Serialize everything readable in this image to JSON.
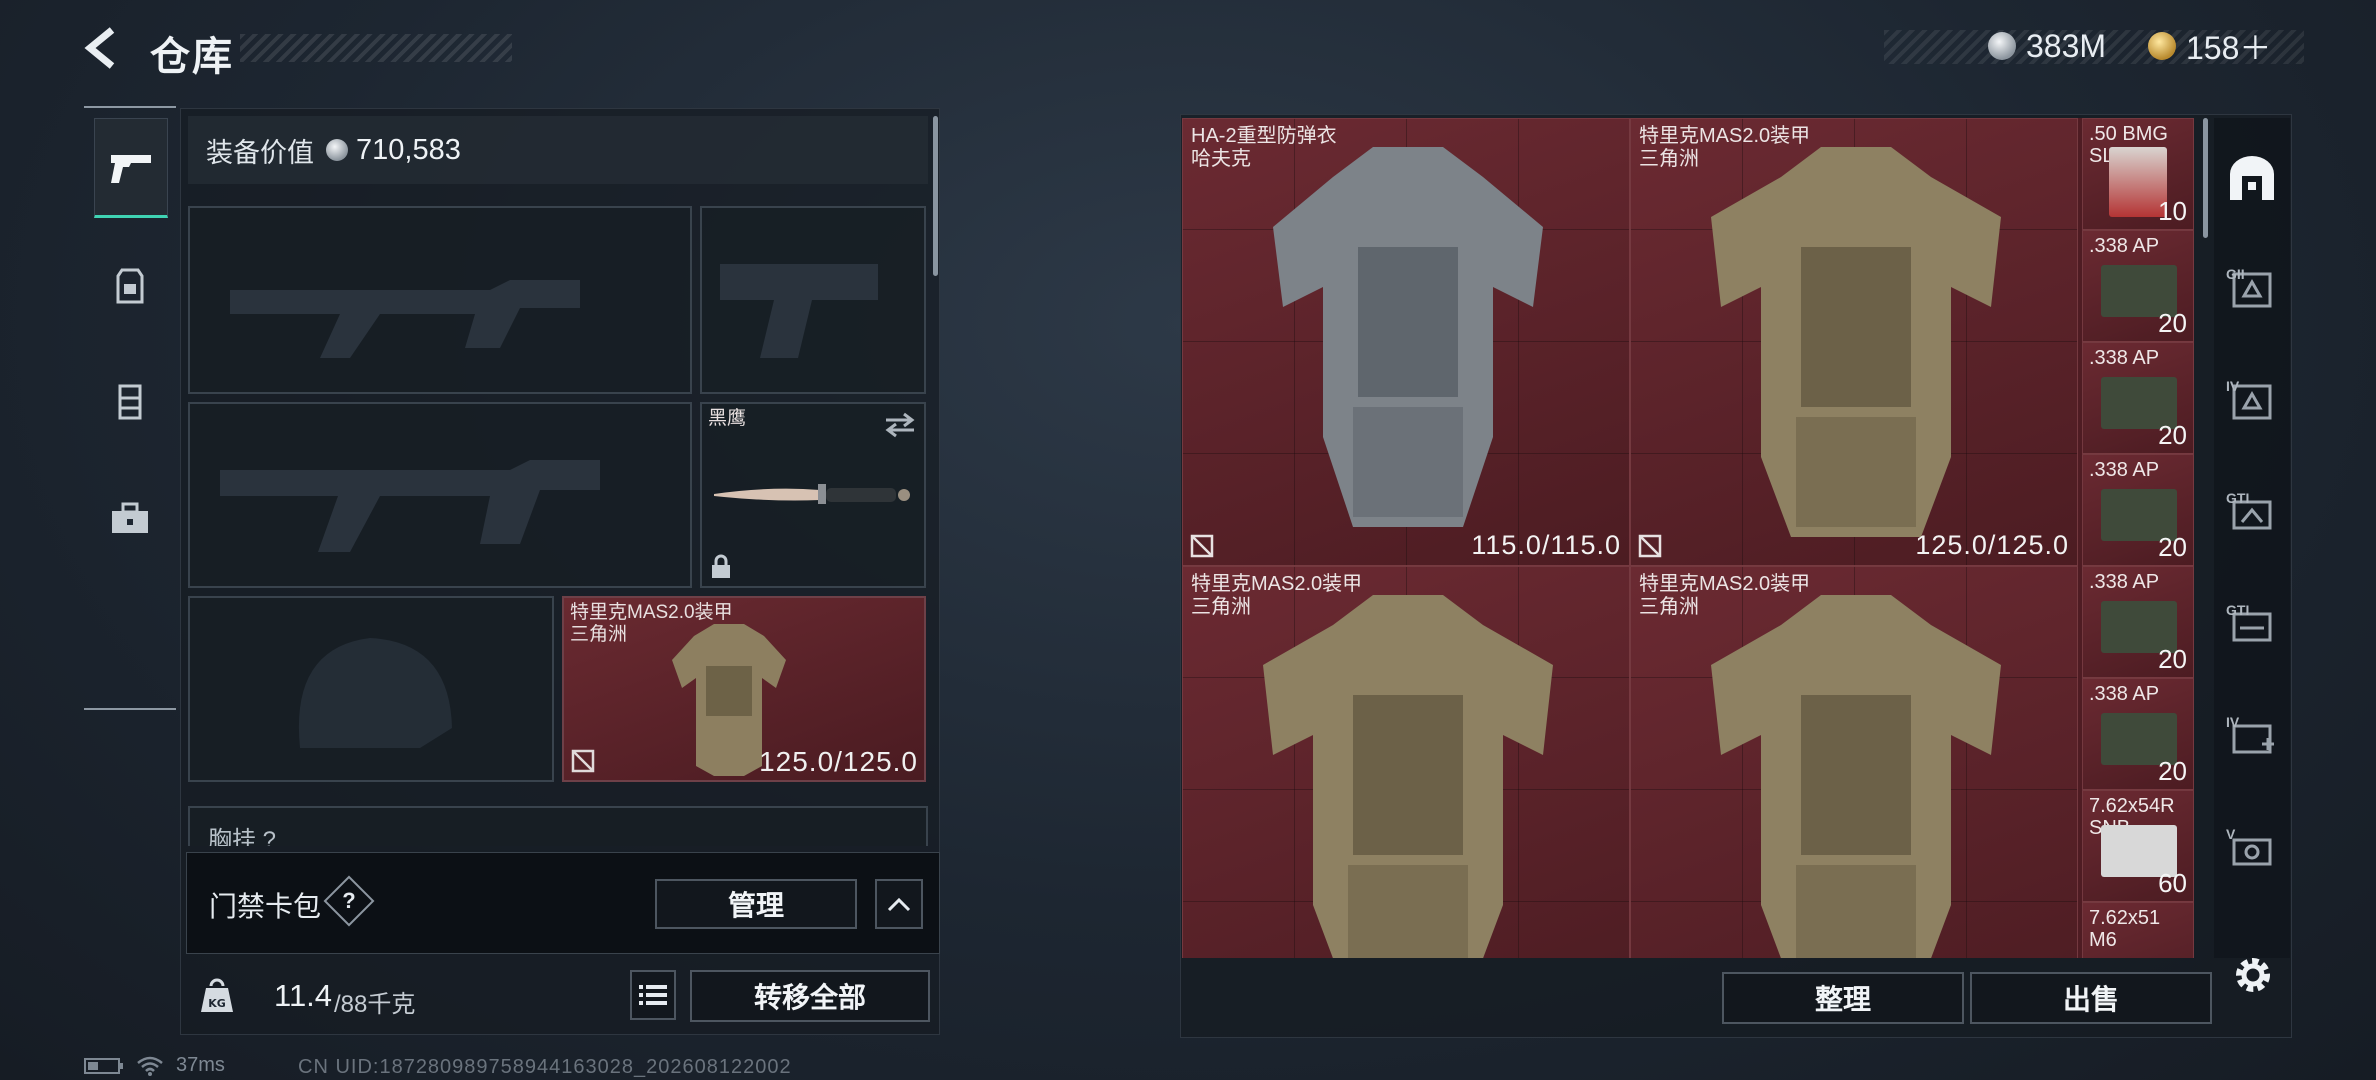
{
  "header": {
    "title": "仓库",
    "currency": [
      {
        "icon": "silver-coin-icon",
        "value": "383M"
      },
      {
        "icon": "gold-coin-icon",
        "value": "158＋"
      }
    ]
  },
  "left_nav": {
    "items": [
      {
        "icon": "pistol-icon",
        "active": true
      },
      {
        "icon": "backpack-icon",
        "active": false
      },
      {
        "icon": "chest-rig-icon",
        "active": false
      },
      {
        "icon": "toolbox-icon",
        "active": false
      }
    ]
  },
  "equipment": {
    "value_label": "装备价值",
    "value": "710,583",
    "knife_name": "黑鹰",
    "armor_slot": {
      "name_line1": "特里克MAS2.0装甲",
      "name_line2": "三角洲",
      "durability": "125.0/125.0"
    },
    "next_section_label": "胸挂 ?"
  },
  "keycard": {
    "label": "门禁卡包",
    "help": "?",
    "manage_button": "管理"
  },
  "weight": {
    "current": "11.4",
    "max": "/88千克",
    "transfer_all_button": "转移全部"
  },
  "storage": {
    "items": [
      {
        "name_line1": "HA-2重型防弹衣",
        "name_line2": "哈夫克",
        "durability": "115.0/115.0",
        "color": "gray"
      },
      {
        "name_line1": "特里克MAS2.0装甲",
        "name_line2": "三角洲",
        "durability": "125.0/125.0",
        "color": "camo"
      },
      {
        "name_line1": "特里克MAS2.0装甲",
        "name_line2": "三角洲",
        "durability": "",
        "color": "camo"
      },
      {
        "name_line1": "特里克MAS2.0装甲",
        "name_line2": "三角洲",
        "durability": "",
        "color": "camo"
      }
    ],
    "ammo": [
      {
        "name": ".50 BMG SLAP",
        "count": "10"
      },
      {
        "name": ".338 AP",
        "count": "20"
      },
      {
        "name": ".338 AP",
        "count": "20"
      },
      {
        "name": ".338 AP",
        "count": "20"
      },
      {
        "name": ".338 AP",
        "count": "20"
      },
      {
        "name": ".338 AP",
        "count": "20"
      },
      {
        "name": "7.62x54R SNB",
        "count": "60"
      },
      {
        "name": "7.62x51 M6",
        "count": ""
      }
    ],
    "sort_button": "整理",
    "sell_button": "出售"
  },
  "right_sidebar": {
    "items": [
      {
        "icon": "safehouse-icon",
        "label": ""
      },
      {
        "icon": "container-gii-icon",
        "label": "GII"
      },
      {
        "icon": "container-iv-icon",
        "label": "IV"
      },
      {
        "icon": "container-gti-icon",
        "label": "GTI"
      },
      {
        "icon": "container-gti2-icon",
        "label": "GTI"
      },
      {
        "icon": "container-iv-add-icon",
        "label": "IV"
      },
      {
        "icon": "container-v-icon",
        "label": "V"
      }
    ]
  },
  "status": {
    "ping": "37ms",
    "uid": "CN UID:187280989758944163028_202608122002"
  }
}
